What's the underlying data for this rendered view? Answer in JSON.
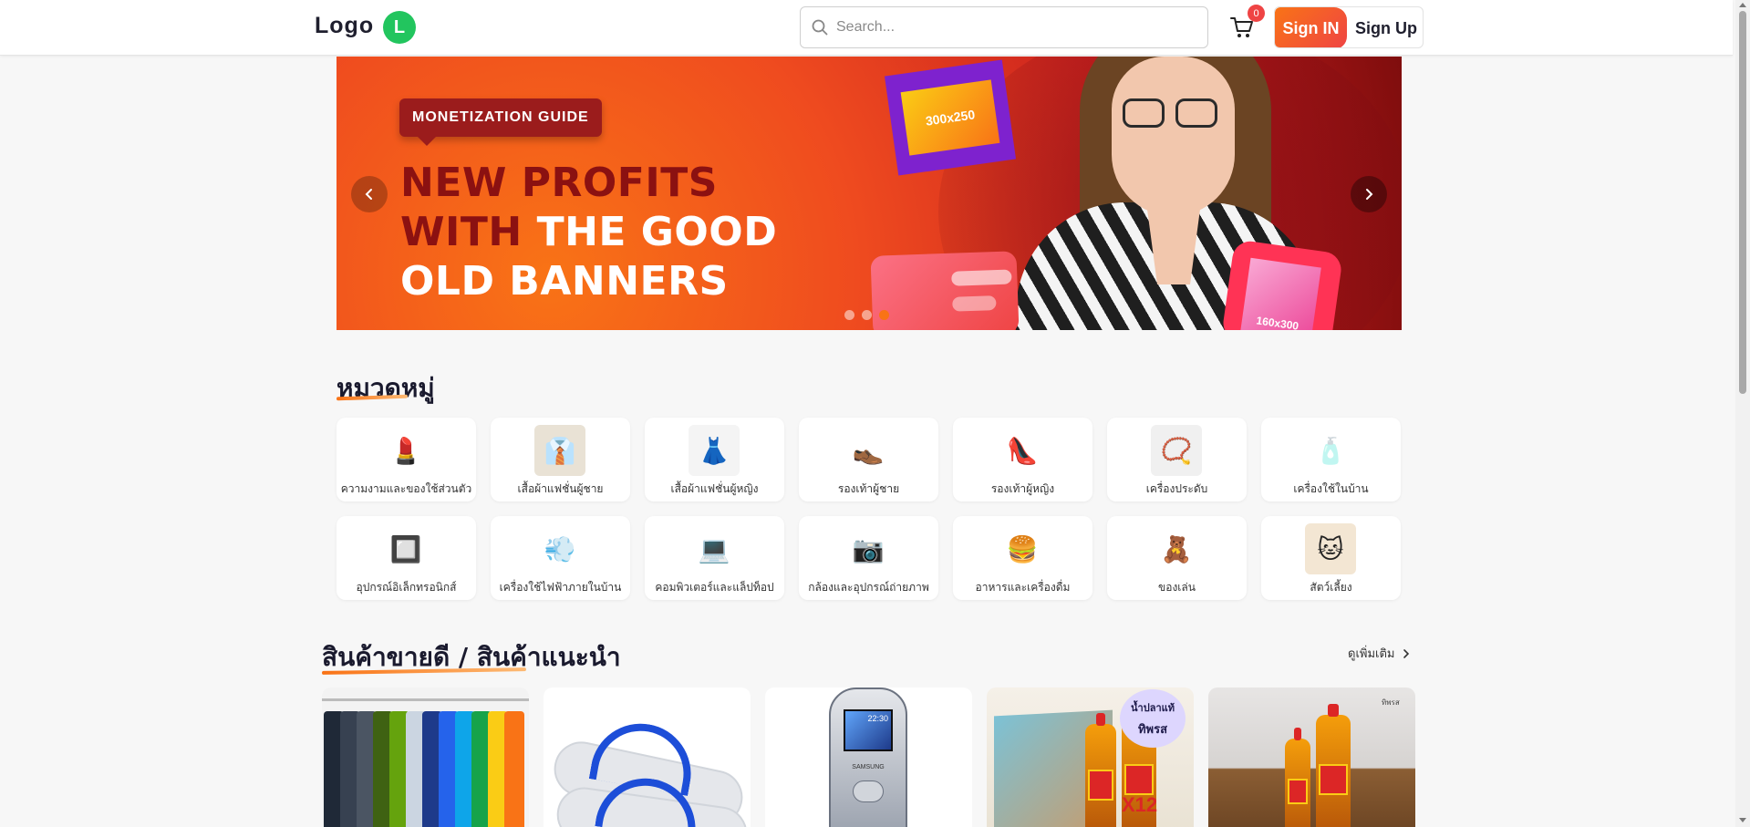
{
  "header": {
    "logo_text": "Logo",
    "logo_badge": "L",
    "search_placeholder": "Search...",
    "cart_count": "0",
    "signin_label": "Sign IN",
    "signup_label": "Sign Up"
  },
  "banner": {
    "tag": "MONETIZATION GUIDE",
    "headline_line1": "NEW PROFITS",
    "headline_line2_dark": "WITH ",
    "headline_line2_white": "THE GOOD",
    "headline_line3": "OLD BANNERS",
    "box1_text": "300x250",
    "box3_text": "160x300",
    "slide_count": 3,
    "active_slide": 3
  },
  "categories": {
    "title": "หมวดหมู่",
    "items": [
      {
        "label": "ความงามและของใช้ส่วนตัว",
        "icon": "lipstick-icon",
        "glyph": "💄"
      },
      {
        "label": "เสื้อผ้าแฟชั่นผู้ชาย",
        "icon": "shirt-icon",
        "glyph": "👔"
      },
      {
        "label": "เสื้อผ้าแฟชั่นผู้หญิง",
        "icon": "dress-icon",
        "glyph": "👗"
      },
      {
        "label": "รองเท้าผู้ชาย",
        "icon": "mens-shoe-icon",
        "glyph": "👞"
      },
      {
        "label": "รองเท้าผู้หญิง",
        "icon": "high-heel-icon",
        "glyph": "👠"
      },
      {
        "label": "เครื่องประดับ",
        "icon": "necklace-icon",
        "glyph": "📿"
      },
      {
        "label": "เครื่องใช้ในบ้าน",
        "icon": "humidifier-icon",
        "glyph": "🧴"
      },
      {
        "label": "อุปกรณ์อิเล็กทรอนิกส์",
        "icon": "chip-icon",
        "glyph": "🔲"
      },
      {
        "label": "เครื่องใช้ไฟฟ้าภายในบ้าน",
        "icon": "hair-dryer-icon",
        "glyph": "💨"
      },
      {
        "label": "คอมพิวเตอร์และแล็ปท็อป",
        "icon": "laptop-icon",
        "glyph": "💻"
      },
      {
        "label": "กล้องและอุปกรณ์ถ่ายภาพ",
        "icon": "camera-icon",
        "glyph": "📷"
      },
      {
        "label": "อาหารและเครื่องดื่ม",
        "icon": "food-drink-icon",
        "glyph": "🍔"
      },
      {
        "label": "ของเล่น",
        "icon": "teddy-bear-icon",
        "glyph": "🧸"
      },
      {
        "label": "สัตว์เลี้ยง",
        "icon": "cat-icon",
        "glyph": "🐱"
      }
    ]
  },
  "bestsellers": {
    "title": "สินค้าขายดี / สินค้าแนะนำ",
    "see_more": "ดูเพิ่มเติม",
    "products": [
      {
        "image": "t-shirts-on-rack"
      },
      {
        "image": "blue-flip-flops"
      },
      {
        "image": "samsung-feature-phone",
        "screen_time": "22:30",
        "brand": "SAMSUNG"
      },
      {
        "image": "fish-sauce-box",
        "badge_line1": "น้ำปลาแท้",
        "badge_line2": "ทิพรส",
        "multiplier": "X12"
      },
      {
        "image": "fish-sauce-bottles",
        "tag": "ทิพรส"
      }
    ]
  },
  "colors": {
    "accent": "#f97316",
    "signin_gradient_end": "#ef4444",
    "logo_badge": "#22c55e",
    "cart_badge": "#ef4444"
  }
}
